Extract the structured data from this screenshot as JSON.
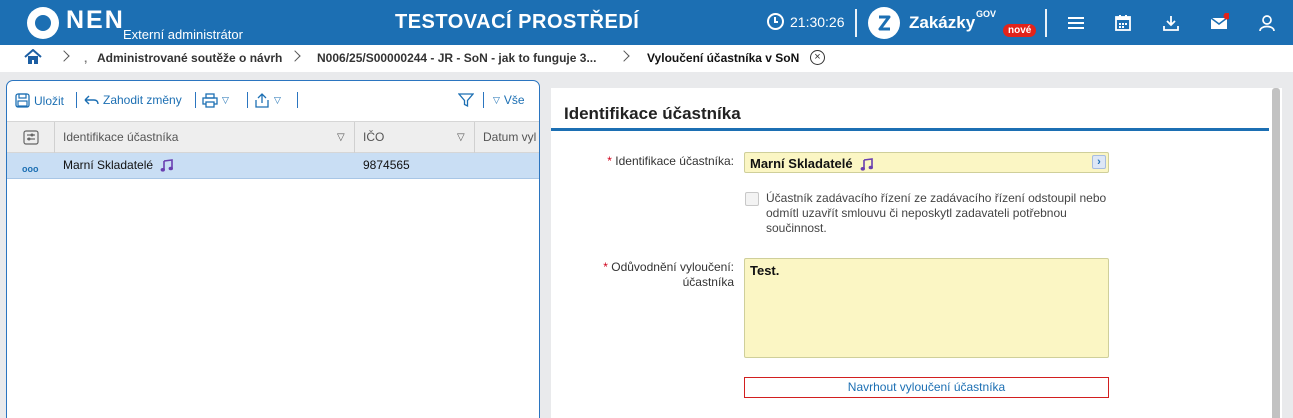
{
  "header": {
    "logo": "NEN",
    "logo_subtitle": "Externí administrátor",
    "environment_title": "TESTOVACÍ PROSTŘEDÍ",
    "time": "21:30:26",
    "zakazky_label": "Zakázky",
    "zakazky_gov": "GOV",
    "zakazky_badge": "nové",
    "icons": [
      "menu-icon",
      "calendar-icon",
      "download-icon",
      "mail-icon",
      "user-icon"
    ],
    "accent_color": "#1c6fb3"
  },
  "breadcrumb": {
    "items": [
      "Administrované soutěže o návrh",
      "N006/25/S00000244 - JR - SoN - jak to funguje 3...",
      "Vyloučení účastníka v SoN"
    ],
    "close": "×"
  },
  "toolbar": {
    "save": "Uložit",
    "discard": "Zahodit změny",
    "all_filter": "Vše"
  },
  "grid": {
    "columns": [
      "Identifikace účastníka",
      "IČO",
      "Datum vyl"
    ],
    "rows": [
      {
        "name": "Marní Skladatelé",
        "ico": "9874565",
        "date": ""
      }
    ],
    "row_action": "ooo"
  },
  "detail": {
    "title": "Identifikace účastníka",
    "participant_label": "Identifikace účastníka:",
    "participant_value": "Marní Skladatelé",
    "withdrawn_checkbox_label": "Účastník zadávacího řízení ze zadávacího řízení odstoupil nebo odmítl uzavřít smlouvu či neposkytl zadavateli potřebnou součinnost.",
    "withdrawn_checked": false,
    "reason_label_1": "Odůvodnění vyloučení:",
    "reason_label_2": "účastníka",
    "reason_value": "Test.",
    "propose_button": "Navrhout vyloučení účastníka",
    "required_mark": "*"
  }
}
